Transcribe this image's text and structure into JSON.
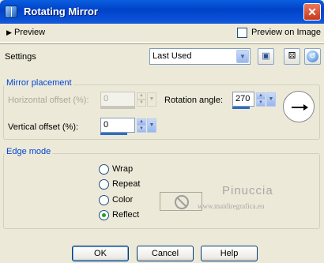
{
  "window": {
    "title": "Rotating Mirror",
    "close_glyph": "✕"
  },
  "preview_bar": {
    "label": "Preview",
    "arrow_glyph": "▶",
    "preview_on_image_label": "Preview on Image",
    "preview_on_image_checked": false
  },
  "settings": {
    "label": "Settings",
    "value": "Last Used"
  },
  "mirror_placement": {
    "legend": "Mirror placement",
    "horizontal_offset_label": "Horizontal offset (%):",
    "horizontal_offset_value": "0",
    "horizontal_offset_enabled": false,
    "vertical_offset_label": "Vertical offset (%):",
    "vertical_offset_value": "0",
    "rotation_angle_label": "Rotation angle:",
    "rotation_angle_value": "270"
  },
  "edge_mode": {
    "legend": "Edge mode",
    "options": [
      {
        "label": "Wrap",
        "selected": false
      },
      {
        "label": "Repeat",
        "selected": false
      },
      {
        "label": "Color",
        "selected": false
      },
      {
        "label": "Reflect",
        "selected": true
      }
    ]
  },
  "watermark": {
    "name": "Pinuccia",
    "url": "www.maidiregrafica.eu"
  },
  "buttons": {
    "ok": "OK",
    "cancel": "Cancel",
    "help": "Help"
  },
  "icons": {
    "window": "app-icon",
    "save": "save-icon",
    "randomize": "dice-icon",
    "reset": "reset-icon",
    "direction": "arrow-right-icon",
    "no_color": "no-symbol-icon"
  },
  "colors": {
    "title_bar": "#0A5FE0",
    "group_legend": "#0046D5",
    "radio_selected": "#21A121",
    "spin_slider": "#316AC5"
  }
}
